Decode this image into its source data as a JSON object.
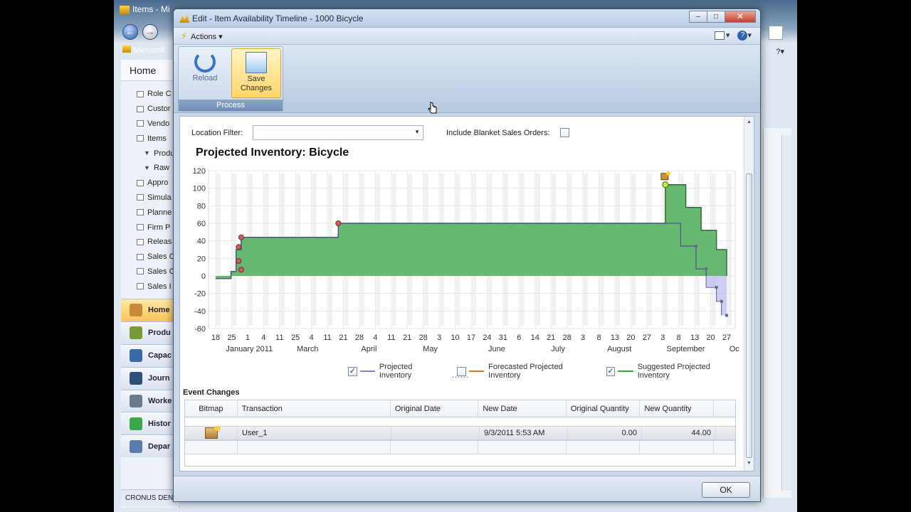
{
  "background_window": {
    "title": "Items - Mi",
    "brand": "Microsoft",
    "home_label": "Home",
    "nav_items": [
      {
        "label": "Role C",
        "sub": false
      },
      {
        "label": "Custor",
        "sub": false
      },
      {
        "label": "Vendo",
        "sub": false
      },
      {
        "label": "Items",
        "sub": false
      },
      {
        "label": "Produ",
        "sub": true
      },
      {
        "label": "Raw",
        "sub": true
      },
      {
        "label": "Appro",
        "sub": false
      },
      {
        "label": "Simula",
        "sub": false
      },
      {
        "label": "Planne",
        "sub": false
      },
      {
        "label": "Firm P",
        "sub": false
      },
      {
        "label": "Releas",
        "sub": false
      },
      {
        "label": "Sales C",
        "sub": false
      },
      {
        "label": "Sales C",
        "sub": false
      },
      {
        "label": "Sales I",
        "sub": false
      }
    ],
    "groups": [
      {
        "label": "Home",
        "active": true,
        "color": "#c98a3a"
      },
      {
        "label": "Produ",
        "active": false,
        "color": "#7a9a3a"
      },
      {
        "label": "Capac",
        "active": false,
        "color": "#3a6aa8"
      },
      {
        "label": "Journ",
        "active": false,
        "color": "#2f4f7a"
      },
      {
        "label": "Worke",
        "active": false,
        "color": "#6a7a8a"
      },
      {
        "label": "Histor",
        "active": false,
        "color": "#3aa84a"
      },
      {
        "label": "Depar",
        "active": false,
        "color": "#5a7ab0"
      }
    ],
    "status": "CRONUS DEN"
  },
  "dialog": {
    "title": "Edit - Item Availability Timeline - 1000 Bicycle",
    "actions_label": "Actions",
    "ribbon": {
      "reload_label": "Reload",
      "save_label": "Save Changes",
      "group_label": "Process"
    },
    "filters": {
      "location_label": "Location Filter:",
      "location_value": "",
      "blanket_label": "Include Blanket Sales Orders:",
      "blanket_checked": false
    },
    "chart_title": "Projected Inventory: Bicycle",
    "legend": [
      {
        "label": "Projected Inventory",
        "checked": true,
        "color": "#7d86d8"
      },
      {
        "label": "Forecasted Projected Inventory",
        "checked": false,
        "color": "#d97a30"
      },
      {
        "label": "Suggested Projected Inventory",
        "checked": true,
        "color": "#3aaa3a"
      }
    ],
    "dots": "......",
    "event_changes_label": "Event Changes",
    "table": {
      "columns": [
        "Bitmap",
        "Transaction",
        "Original Date",
        "New Date",
        "Original Quantity",
        "New Quantity"
      ],
      "rows": [
        {
          "transaction": "User_1",
          "original_date": "",
          "new_date": "9/3/2011 5:53 AM",
          "original_quantity": "0.00",
          "new_quantity": "44.00"
        }
      ]
    },
    "ok_label": "OK"
  },
  "chart_data": {
    "type": "area",
    "ylim": [
      -60,
      120
    ],
    "yticks": [
      -60,
      -40,
      -20,
      0,
      20,
      40,
      60,
      80,
      100,
      120
    ],
    "xtick_labels": [
      "18",
      "25",
      "1",
      "4",
      "11",
      "25",
      "4",
      "11",
      "21",
      "28",
      "4",
      "11",
      "21",
      "28",
      "3",
      "10",
      "17",
      "24",
      "31",
      "6",
      "14",
      "21",
      "28",
      "3",
      "8",
      "13",
      "20",
      "27",
      "3",
      "8",
      "13",
      "20",
      "27"
    ],
    "month_labels": [
      "January 2011",
      "March",
      "April",
      "May",
      "June",
      "July",
      "August",
      "September",
      "Oc"
    ],
    "grid": true,
    "series": [
      {
        "name": "Suggested Projected Inventory",
        "color": "#3aaa3a",
        "points": [
          [
            0.0,
            -3
          ],
          [
            0.03,
            -3
          ],
          [
            0.03,
            5
          ],
          [
            0.04,
            5
          ],
          [
            0.04,
            30
          ],
          [
            0.05,
            30
          ],
          [
            0.05,
            44
          ],
          [
            0.24,
            44
          ],
          [
            0.24,
            60
          ],
          [
            0.88,
            60
          ],
          [
            0.88,
            104
          ],
          [
            0.92,
            104
          ],
          [
            0.92,
            78
          ],
          [
            0.95,
            78
          ],
          [
            0.95,
            52
          ],
          [
            0.98,
            52
          ],
          [
            0.98,
            30
          ],
          [
            1.0,
            30
          ],
          [
            1.0,
            0
          ]
        ]
      },
      {
        "name": "Projected Inventory",
        "color": "#7d86d8",
        "points": [
          [
            0.0,
            -3
          ],
          [
            0.03,
            -3
          ],
          [
            0.03,
            5
          ],
          [
            0.04,
            5
          ],
          [
            0.04,
            30
          ],
          [
            0.05,
            30
          ],
          [
            0.05,
            44
          ],
          [
            0.24,
            44
          ],
          [
            0.24,
            60
          ],
          [
            0.88,
            60
          ],
          [
            0.88,
            60
          ],
          [
            0.91,
            60
          ],
          [
            0.91,
            34
          ],
          [
            0.94,
            34
          ],
          [
            0.94,
            8
          ],
          [
            0.96,
            8
          ],
          [
            0.96,
            -13
          ],
          [
            0.98,
            -13
          ],
          [
            0.98,
            -29
          ],
          [
            0.99,
            -29
          ],
          [
            0.99,
            -45
          ]
        ]
      }
    ]
  }
}
